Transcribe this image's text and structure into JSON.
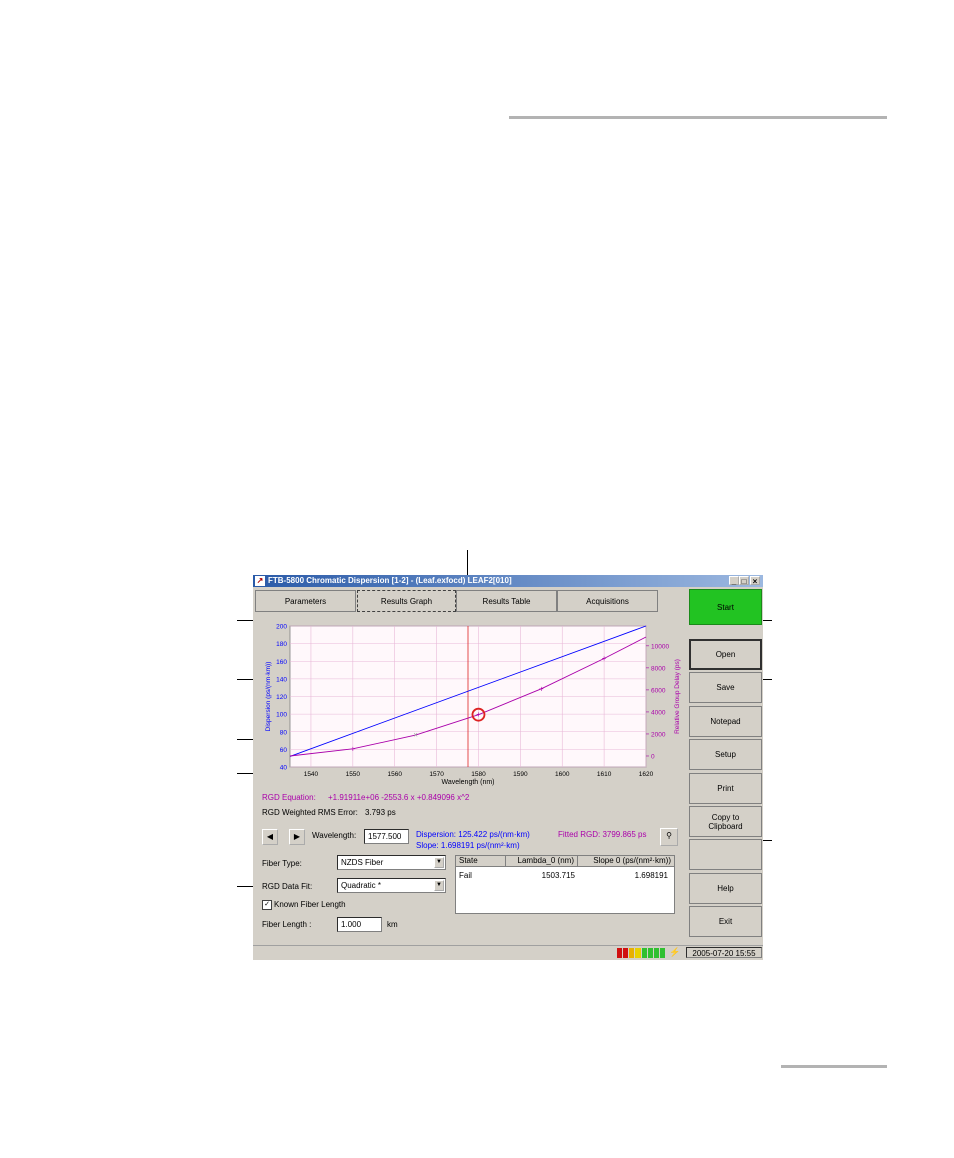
{
  "window": {
    "title": "FTB-5800 Chromatic Dispersion  [1-2] - (Leaf.exfocd) LEAF2[010]",
    "controls": [
      "_",
      "□",
      "×"
    ]
  },
  "tabs": [
    {
      "label": "Parameters",
      "active": false
    },
    {
      "label": "Results Graph",
      "active": true
    },
    {
      "label": "Results Table",
      "active": false
    },
    {
      "label": "Acquisitions",
      "active": false
    }
  ],
  "side_buttons": [
    "Start",
    "Open",
    "Save",
    "Notepad",
    "Setup",
    "Print",
    "Copy to\nClipboard",
    "",
    "Help",
    "Exit"
  ],
  "colors": {
    "start_button": "#22c322",
    "dispersion": "#0000ff",
    "rgd": "#aa00aa",
    "marker": "#dd2222"
  },
  "equation": {
    "label": "RGD Equation:",
    "value": "+1.91911e+06 -2553.6 x +0.849096 x^2"
  },
  "rms": {
    "label": "RGD Weighted RMS Error:",
    "value": "3.793 ps"
  },
  "cursor": {
    "prev_icon": "left-arrow-icon",
    "next_icon": "right-arrow-icon",
    "wavelength_label": "Wavelength:",
    "wavelength_value": "1577.500",
    "dispersion": "Dispersion:  125.422 ps/(nm·km)",
    "slope": "Slope:        1.698191 ps/(nm²·km)",
    "fitted_rgd": "Fitted RGD:  3799.865 ps",
    "zoom_icon": "magnifier-icon"
  },
  "settings": {
    "fiber_type_label": "Fiber Type:",
    "fiber_type_value": "NZDS Fiber",
    "fit_label": "RGD Data Fit:",
    "fit_value": "Quadratic *",
    "known_length_label": "Known Fiber Length",
    "known_length_checked": true,
    "fiber_length_label": "Fiber Length :",
    "fiber_length_value": "1.000",
    "fiber_length_unit": "km"
  },
  "results_table": {
    "headers": [
      "State",
      "Lambda_0 (nm)",
      "Slope 0 (ps/(nm²·km))"
    ],
    "rows": [
      [
        "Fail",
        "1503.715",
        "1.698191"
      ]
    ]
  },
  "status": {
    "timestamp": "2005-07-20 15:55"
  },
  "chart_data": {
    "type": "line",
    "xlabel": "Wavelength (nm)",
    "ylabel": "Dispersion (ps/(nm·km))",
    "y2label": "Relative Group Delay (ps)",
    "xlim": [
      1535,
      1620
    ],
    "ylim": [
      40,
      200
    ],
    "y2lim": [
      -1000,
      11800
    ],
    "x_ticks": [
      1540,
      1550,
      1560,
      1570,
      1580,
      1590,
      1600,
      1610,
      1620
    ],
    "y_ticks": [
      40,
      60,
      80,
      100,
      120,
      140,
      160,
      180,
      200
    ],
    "y2_ticks": [
      0,
      2000,
      4000,
      6000,
      8000,
      10000
    ],
    "grid": true,
    "cursor_x": 1577.5,
    "series": [
      {
        "axis": "left",
        "x": [
          1535,
          1620
        ],
        "y": [
          52,
          200
        ]
      },
      {
        "axis": "right",
        "x": [
          1535,
          1550,
          1565,
          1580,
          1595,
          1610,
          1620
        ],
        "y": [
          0,
          650,
          1900,
          3750,
          6100,
          8850,
          10800
        ]
      }
    ],
    "points": [
      {
        "axis": "right",
        "x": 1550,
        "y": 650,
        "marker": "+"
      },
      {
        "axis": "right",
        "x": 1565,
        "y": 1900,
        "marker": "x"
      },
      {
        "axis": "right",
        "x": 1580,
        "y": 3750,
        "marker": "+"
      },
      {
        "axis": "right",
        "x": 1595,
        "y": 6100,
        "marker": "+"
      },
      {
        "axis": "right",
        "x": 1610,
        "y": 8850,
        "marker": "+"
      }
    ],
    "highlight": {
      "axis": "right",
      "x": 1580,
      "y": 3750
    }
  }
}
